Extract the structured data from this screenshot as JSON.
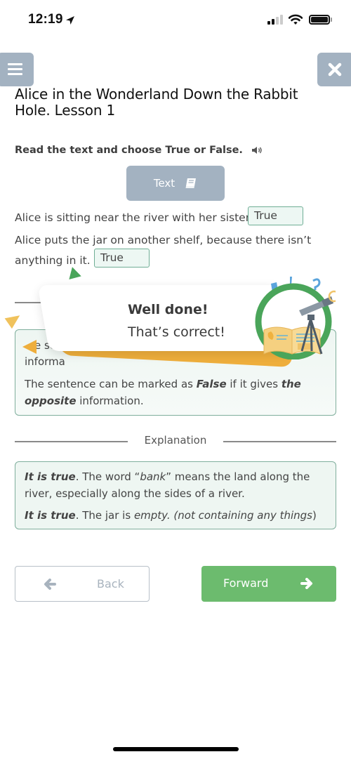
{
  "status_bar": {
    "time": "12:19",
    "icons": [
      "location-arrow-icon",
      "cellular-signal-icon",
      "wifi-icon",
      "battery-icon"
    ]
  },
  "header": {
    "menu_icon": "hamburger-menu-icon",
    "close_icon": "close-x-icon",
    "title": "Alice in the Wonderland Down the Rabbit Hole. Lesson 1"
  },
  "task": {
    "instruction": "Read the text and choose True or False.",
    "audio_icon": "speaker-icon",
    "text_button": {
      "label": "Text",
      "icon": "book-icon"
    },
    "items": [
      {
        "sentence": "Alice is sitting near the river with her sister.",
        "answer": "True"
      },
      {
        "sentence_line1": "Alice puts the jar on another shelf, because there isn’t",
        "sentence_line2": "anything in it.",
        "answer": "True"
      }
    ]
  },
  "rule_box": {
    "line1_visible": "e se",
    "line2_visible": "informa",
    "p2_a": "The sentence can be marked as ",
    "p2_b": "False",
    "p2_c": " if it gives ",
    "p2_d": "the",
    "p2_e": "opposite",
    "p2_f": " information."
  },
  "explanation": {
    "section_label": "Explanation",
    "items": [
      {
        "lead": "It is true",
        "t1": ". The word “",
        "em": "bank",
        "t2": "” means the land along the",
        "t3": "river, especially along the sides of a river."
      },
      {
        "lead": "It is true",
        "t1": ". The jar is ",
        "em": "empty. (not containing any things",
        "t2": ")"
      }
    ]
  },
  "navigation": {
    "back_label": "Back",
    "back_icon": "arrow-left-icon",
    "forward_label": "Forward",
    "forward_icon": "arrow-right-icon"
  },
  "toast": {
    "title": "Well done!",
    "subtitle": "That’s correct!",
    "illustration": "telescope-book-badge-icon"
  },
  "colors": {
    "accent_green": "#6cbb6e",
    "badge_ring": "#4aa55a",
    "button_gray_blue": "#a3b2c1",
    "answer_border": "#6fae95",
    "box_bg": "#eef6f2",
    "toast_orange": "#eeae3c"
  }
}
